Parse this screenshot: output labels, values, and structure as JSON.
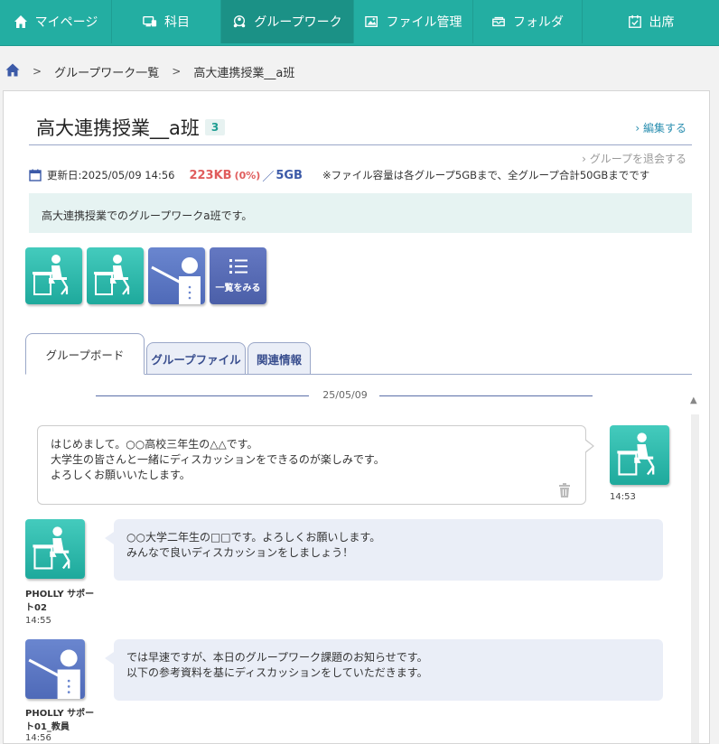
{
  "nav": {
    "items": [
      {
        "label": "マイページ",
        "icon": "home-icon"
      },
      {
        "label": "科目",
        "icon": "subject-icon"
      },
      {
        "label": "グループワーク",
        "icon": "group-icon",
        "active": true
      },
      {
        "label": "ファイル管理",
        "icon": "file-icon"
      },
      {
        "label": "フォルダ",
        "icon": "folder-icon"
      },
      {
        "label": "出席",
        "icon": "attendance-icon"
      }
    ]
  },
  "breadcrumb": {
    "home_icon": "home-icon",
    "items": [
      "グループワーク一覧",
      "高大連携授業__a班"
    ]
  },
  "group": {
    "title": "高大連携授業__a班",
    "member_count": "3",
    "edit_label": "編集する",
    "leave_label": "グループを退会する",
    "updated_label": "更新日:2025/05/09 14:56",
    "used": "223KB",
    "used_pct": "(0%)",
    "slash": "／",
    "capacity": "5GB",
    "note": "※ファイル容量は各グループ5GBまで、全グループ合計50GBまでです",
    "description": "高大連携授業でのグループワークa班です。",
    "list_label": "一覧をみる"
  },
  "tabs": [
    {
      "label": "グループボード",
      "active": true
    },
    {
      "label": "グループファイル"
    },
    {
      "label": "関連情報"
    }
  ],
  "board": {
    "date": "25/05/09",
    "messages": [
      {
        "own": true,
        "lines": [
          "はじめまして。○○高校三年生の△△です。",
          "大学生の皆さんと一緒にディスカッションをできるのが楽しみです。",
          "よろしくお願いいたします。"
        ],
        "time": "14:53"
      },
      {
        "own": false,
        "lines": [
          "○○大学二年生の□□です。よろしくお願いします。",
          "みんなで良いディスカッションをしましょう！"
        ],
        "sender": "PHOLLY サポート02",
        "time": "14:55",
        "role": "student"
      },
      {
        "own": false,
        "lines": [
          "では早速ですが、本日のグループワーク課題のお知らせです。",
          "以下の参考資料を基にディスカッションをしていただきます。"
        ],
        "sender": "PHOLLY サポート01_教員",
        "time": "14:56",
        "role": "teacher"
      }
    ]
  },
  "colors": {
    "nav": "#23aea2",
    "nav_active": "#1b9186",
    "accent_blue": "#3c5aa8",
    "used_red": "#e05d5d",
    "bubble_other": "#eaeef7",
    "desc_bg": "#e6f3f2"
  }
}
